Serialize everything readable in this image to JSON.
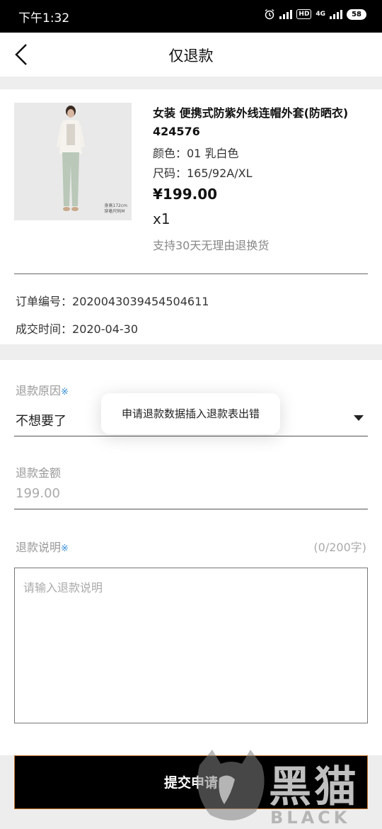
{
  "status_bar": {
    "time": "下午1:32",
    "hd": "HD",
    "network": "4G",
    "battery": "58"
  },
  "nav": {
    "title": "仅退款"
  },
  "product": {
    "name": "女装 便携式防紫外线连帽外套(防晒衣)",
    "code": "424576",
    "color": "颜色：01 乳白色",
    "size": "尺码：165/92A/XL",
    "price": "¥199.00",
    "quantity": "x1",
    "return_policy": "支持30天无理由退换货",
    "image_caption_1": "身高172cm",
    "image_caption_2": "穿着尺码M"
  },
  "order": {
    "number_label": "订单编号：",
    "number": "2020043039454504611",
    "time_label": "成交时间：",
    "time": "2020-04-30"
  },
  "form": {
    "reason_label": "退款原因",
    "reason_value": "不想要了",
    "required_mark": "※",
    "amount_label": "退款金额",
    "amount_value": "199.00",
    "note_label": "退款说明",
    "note_counter": "(0/200字)",
    "note_placeholder": "请输入退款说明"
  },
  "toast": {
    "message": "申请退款数据插入退款表出错"
  },
  "submit": {
    "label": "提交申请"
  },
  "watermark": {
    "cn": "黑猫",
    "en": "BLACK CAT"
  },
  "colors": {
    "required_mark": "#3b8fd8",
    "submit_bg": "#000000",
    "submit_border": "#c8772d",
    "section_gap": "#eeeeee"
  }
}
